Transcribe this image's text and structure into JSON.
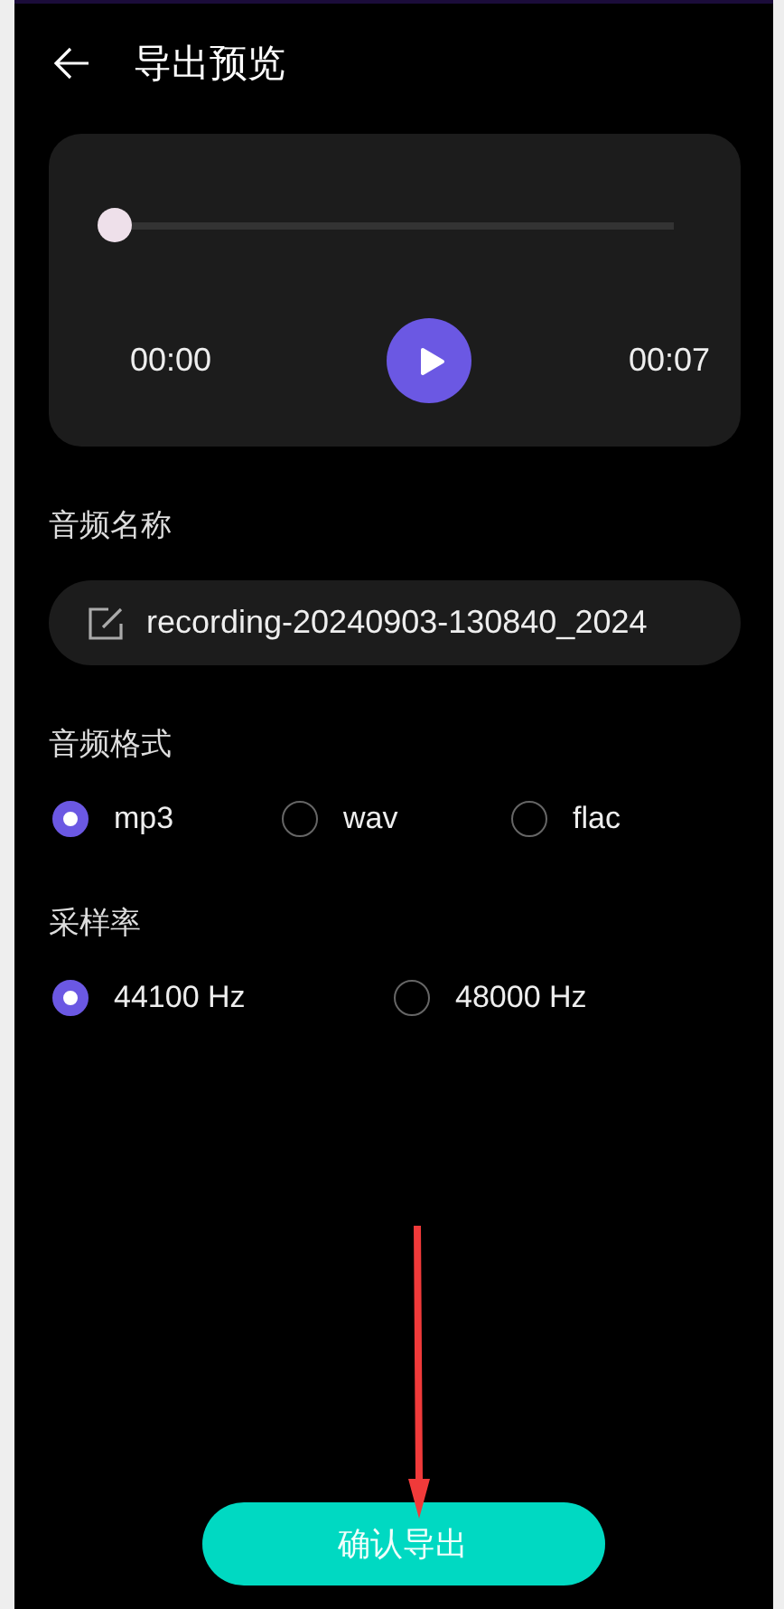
{
  "header": {
    "title": "导出预览"
  },
  "player": {
    "level": 0,
    "elapsed": "00:00",
    "duration": "00:07",
    "playing": false
  },
  "name_field": {
    "label": "音频名称",
    "value": "recording-20240903-130840_2024"
  },
  "format": {
    "label": "音频格式",
    "options": [
      {
        "label": "mp3",
        "selected": true
      },
      {
        "label": "wav",
        "selected": false
      },
      {
        "label": "flac",
        "selected": false
      }
    ]
  },
  "sample_rate": {
    "label": "采样率",
    "options": [
      {
        "label": "44100 Hz",
        "selected": true
      },
      {
        "label": "48000 Hz",
        "selected": false
      }
    ]
  },
  "confirm_button": {
    "label": "确认导出"
  },
  "annotation": {
    "kind": "arrow"
  }
}
